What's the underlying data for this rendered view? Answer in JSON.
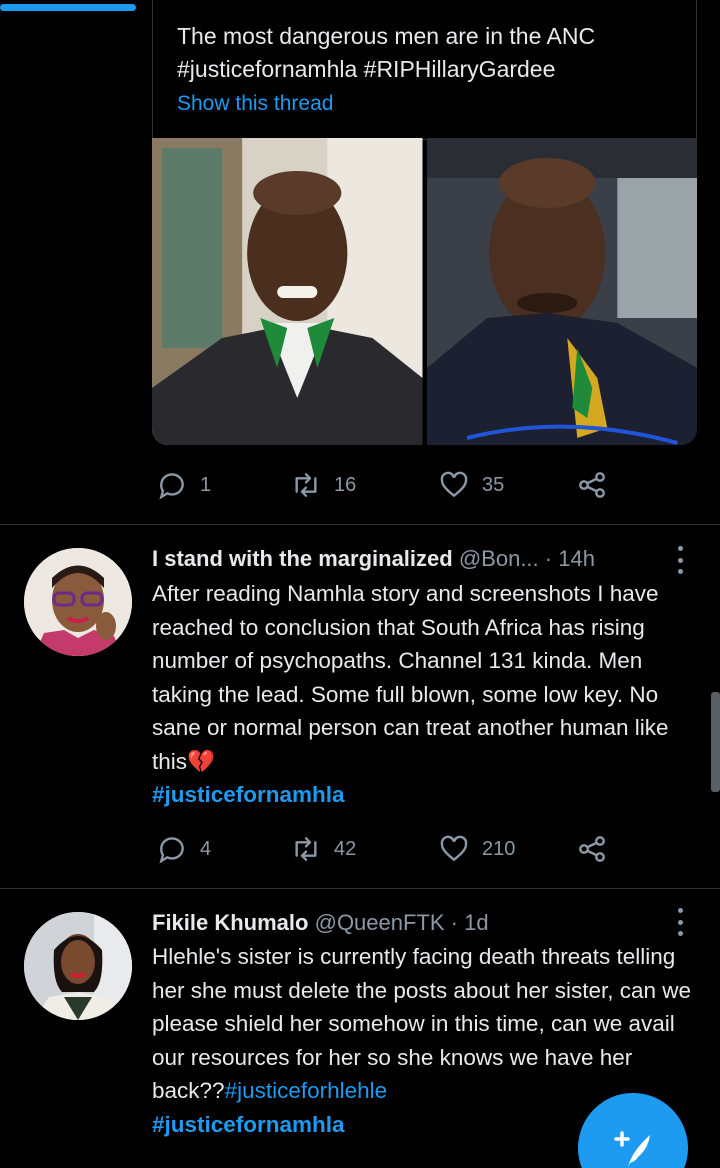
{
  "quoted_tweet": {
    "text": "The most dangerous men are in the ANC\n#justicefornamhla #RIPHillaryGardee",
    "show_thread": "Show this thread",
    "stats": {
      "replies": "1",
      "retweets": "16",
      "likes": "35"
    }
  },
  "tweets": [
    {
      "name": "I stand with the marginalized",
      "handle": "@Bon...",
      "time": "· 14h",
      "body": "After reading Namhla story and screenshots I have reached to conclusion that South Africa has rising number of psychopaths. Channel 131 kinda. Men taking the lead. Some full blown, some low key. No sane or normal person can treat another human like this💔",
      "hashtag": "#justicefornamhla",
      "stats": {
        "replies": "4",
        "retweets": "42",
        "likes": "210"
      }
    },
    {
      "name": "Fikile Khumalo",
      "handle": "@QueenFTK",
      "time": "· 1d",
      "body": "Hlehle's sister is currently facing death threats telling her she must delete the posts about her sister, can we please shield her somehow in this time, can we avail our resources for her so she knows we have her back??",
      "inline_hashtag": "#justiceforhlehle",
      "hashtag": "#justicefornamhla"
    }
  ],
  "colors": {
    "accent": "#1d9bf0",
    "background": "#000000",
    "muted": "#8b98a5"
  },
  "icons": [
    "reply-icon",
    "retweet-icon",
    "like-icon",
    "share-icon",
    "more-icon",
    "compose-icon"
  ]
}
